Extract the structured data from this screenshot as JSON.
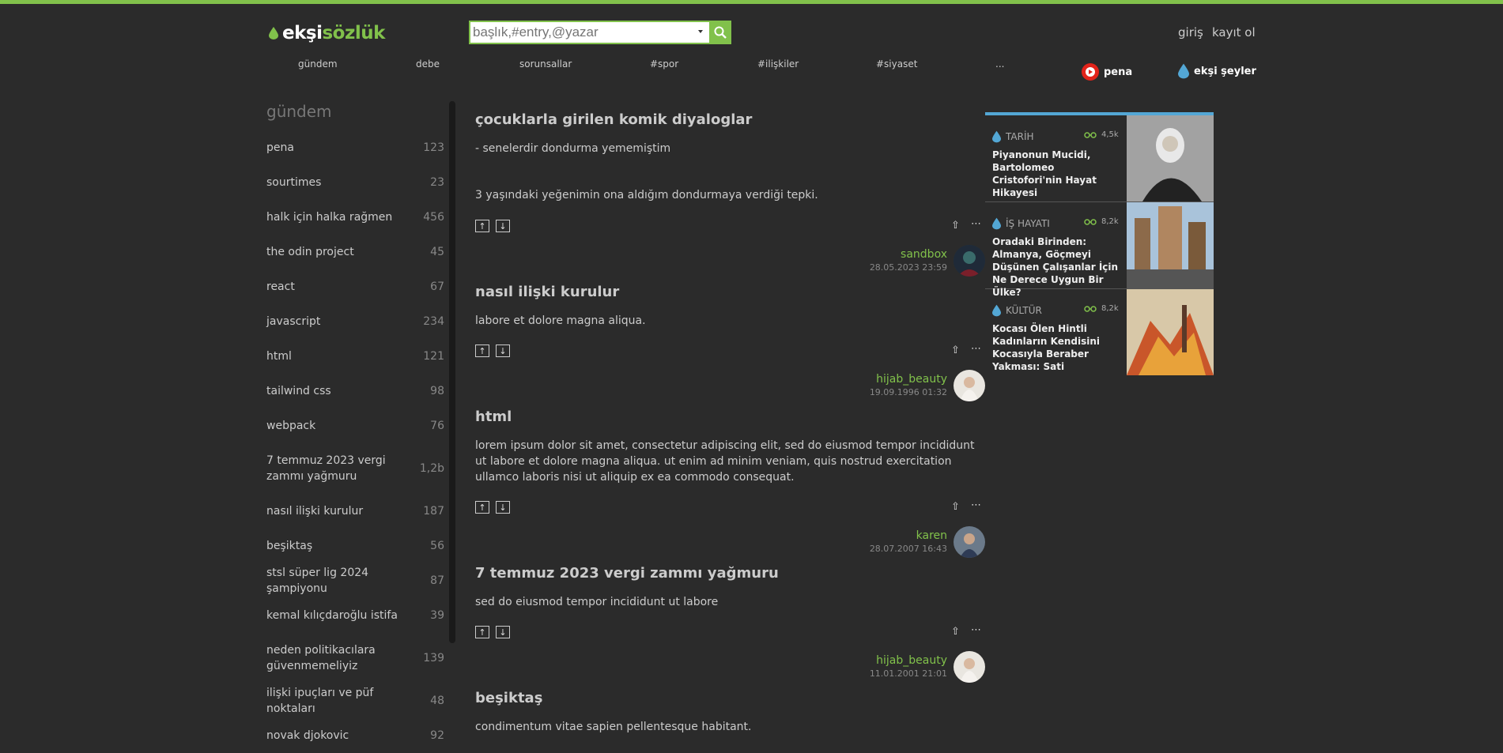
{
  "header": {
    "logo_part1": "ekşi",
    "logo_part2": "sözlük",
    "search_placeholder": "başlık,#entry,@yazar",
    "login": "giriş",
    "register": "kayıt ol"
  },
  "nav": {
    "items": [
      "gündem",
      "debe",
      "sorunsallar",
      "#spor",
      "#ilişkiler",
      "#siyaset",
      "..."
    ],
    "pena": "pena",
    "eksi_seyler": "ekşi şeyler"
  },
  "sidebar": {
    "title": "gündem",
    "items": [
      {
        "label": "pena",
        "count": "123"
      },
      {
        "label": "sourtimes",
        "count": "23"
      },
      {
        "label": "halk için halka rağmen",
        "count": "456"
      },
      {
        "label": "the odin project",
        "count": "45"
      },
      {
        "label": "react",
        "count": "67"
      },
      {
        "label": "javascript",
        "count": "234"
      },
      {
        "label": "html",
        "count": "121"
      },
      {
        "label": "tailwind css",
        "count": "98"
      },
      {
        "label": "webpack",
        "count": "76"
      },
      {
        "label": "7 temmuz 2023 vergi zammı yağmuru",
        "count": "1,2b"
      },
      {
        "label": "nasıl ilişki kurulur",
        "count": "187"
      },
      {
        "label": "beşiktaş",
        "count": "56"
      },
      {
        "label": "stsl süper lig 2024 şampiyonu",
        "count": "87"
      },
      {
        "label": "kemal kılıçdaroğlu istifa",
        "count": "39"
      },
      {
        "label": "neden politikacılara güvenmemeliyiz",
        "count": "139"
      },
      {
        "label": "ilişki ipuçları ve püf noktaları",
        "count": "48"
      },
      {
        "label": "novak djokovic",
        "count": "92"
      }
    ]
  },
  "entries": [
    {
      "title": "çocuklarla girilen komik diyaloglar",
      "body1": "- senelerdir dondurma yememiştim",
      "body2": "3 yaşındaki yeğenimin ona aldığım dondurmaya verdiği tepki.",
      "author": "sandbox",
      "date": "28.05.2023 23:59"
    },
    {
      "title": "nasıl ilişki kurulur",
      "body1": "labore et dolore magna aliqua.",
      "author": "hijab_beauty",
      "date": "19.09.1996 01:32"
    },
    {
      "title": "html",
      "body1": "lorem ipsum dolor sit amet, consectetur adipiscing elit, sed do eiusmod tempor incididunt ut labore et dolore magna aliqua. ut enim ad minim veniam, quis nostrud exercitation ullamco laboris nisi ut aliquip ex ea commodo consequat.",
      "author": "karen",
      "date": "28.07.2007 16:43"
    },
    {
      "title": "7 temmuz 2023 vergi zammı yağmuru",
      "body1": "sed do eiusmod tempor incididunt ut labore",
      "author": "hijab_beauty",
      "date": "11.01.2001 21:01"
    },
    {
      "title": "beşiktaş",
      "body1": "condimentum vitae sapien pellentesque habitant."
    }
  ],
  "cards": [
    {
      "category": "TARİH",
      "views": "4,5k",
      "title": "Piyanonun Mucidi, Bartolomeo Cristofori'nin Hayat Hikayesi"
    },
    {
      "category": "İŞ HAYATI",
      "views": "8,2k",
      "title": "Oradaki Birinden: Almanya, Göçmeyi Düşünen Çalışanlar İçin Ne Derece Uygun Bir Ülke?"
    },
    {
      "category": "KÜLTÜR",
      "views": "8,2k",
      "title": "Kocası Ölen Hintli Kadınların Kendisini Kocasıyla Beraber Yakması: Sati"
    }
  ],
  "colors": {
    "accent": "#81c14b",
    "background": "#2b2b2b",
    "rail": "#53a7d5"
  }
}
